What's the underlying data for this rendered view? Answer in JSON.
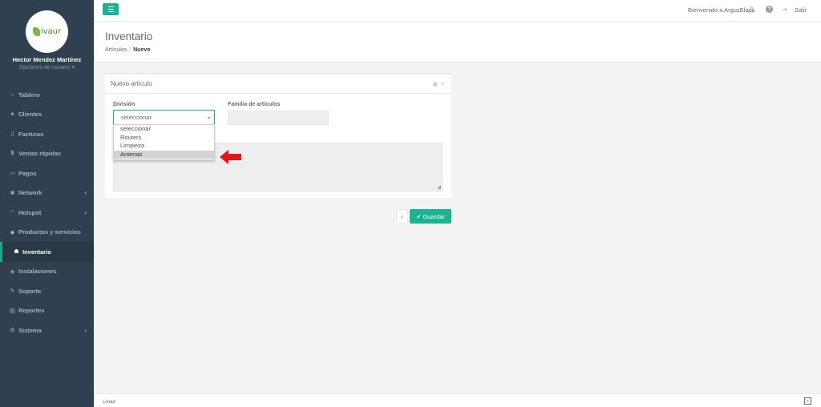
{
  "sidebar": {
    "logo_text": "ivaur",
    "user_name": "Hector Mendez Martínez",
    "user_options": "Opciones de usuario ▾",
    "items": [
      {
        "label": "Tablero",
        "icon": "dashboard-icon"
      },
      {
        "label": "Clientes",
        "icon": "users-icon"
      },
      {
        "label": "Facturas",
        "icon": "invoice-icon"
      },
      {
        "label": "Ventas rápidas",
        "icon": "dollar-icon"
      },
      {
        "label": "Pagos",
        "icon": "payments-icon"
      },
      {
        "label": "Network",
        "icon": "network-icon"
      },
      {
        "label": "Hotspot",
        "icon": "wifi-icon"
      },
      {
        "label": "Productos y servicios",
        "icon": "tags-icon"
      },
      {
        "label": "Inventario",
        "icon": "inventory-icon"
      },
      {
        "label": "Instalaciones",
        "icon": "installations-icon"
      },
      {
        "label": "Soporte",
        "icon": "wrench-icon"
      },
      {
        "label": "Reportes",
        "icon": "book-icon"
      },
      {
        "label": "Sistema",
        "icon": "cogs-icon"
      }
    ]
  },
  "topbar": {
    "welcome": "Bienvenido a ArgusBlack",
    "logout": "Salir"
  },
  "heading": {
    "title": "Inventario",
    "crumb_parent": "Artículos",
    "crumb_current": "Nuevo"
  },
  "panel": {
    "title": "Nuevo artículo",
    "division_label": "División",
    "family_label": "Familia de artículos",
    "select_value": "seleccionar",
    "options": [
      "seleccionar",
      "Routers",
      "Limpieza",
      "Antenas"
    ],
    "highlighted_option": "Antenas"
  },
  "actions": {
    "back": "‹",
    "save": "Guardar"
  },
  "footer": {
    "text": "Livaur"
  },
  "colors": {
    "accent": "#1ab394",
    "sidebar": "#2f4050",
    "annotation_arrow": "#e0191b"
  }
}
